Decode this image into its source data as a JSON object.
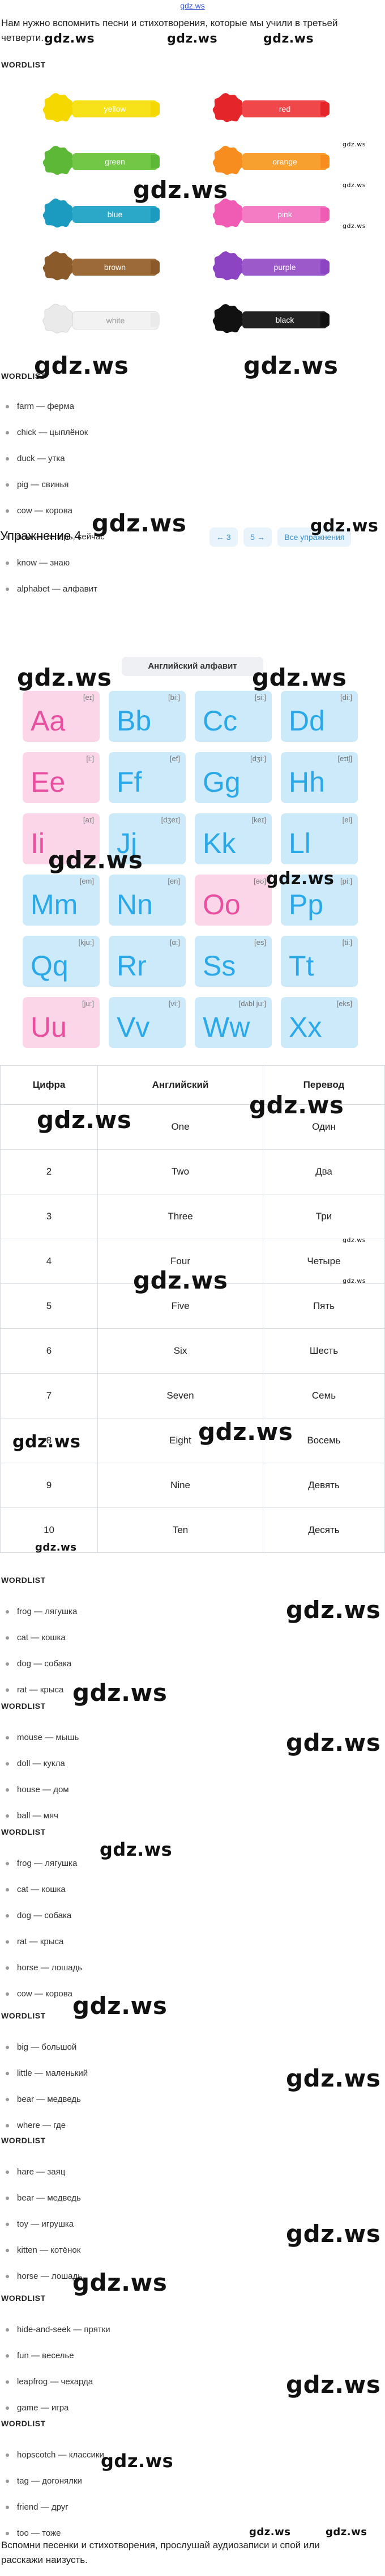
{
  "top_link": "gdz.ws",
  "intro_text": "Нам нужно вспомнить песни и стихотворения, которые мы учили в третьей четверти.",
  "wordlist_label": "WORDLIST",
  "watermarks": {
    "big": "gdz.ws",
    "small": "gdz.ws"
  },
  "highlighters": [
    {
      "label": "yellow",
      "color": "#f7e21a",
      "splat": "#f5d800"
    },
    {
      "label": "red",
      "color": "#f0484a",
      "splat": "#e4262a"
    },
    {
      "label": "green",
      "color": "#72c846",
      "splat": "#5db837"
    },
    {
      "label": "orange",
      "color": "#f7a030",
      "splat": "#f68d1e"
    },
    {
      "label": "blue",
      "color": "#2ba8c8",
      "splat": "#1a9bbf"
    },
    {
      "label": "pink",
      "color": "#f47cc5",
      "splat": "#f05cb4"
    },
    {
      "label": "brown",
      "color": "#9c6a38",
      "splat": "#8a5a2a"
    },
    {
      "label": "purple",
      "color": "#9b59c9",
      "splat": "#8c44c2"
    },
    {
      "label": "white",
      "color": "#f2f2f2",
      "splat": "#eaeaea"
    },
    {
      "label": "black",
      "color": "#222222",
      "splat": "#111111"
    }
  ],
  "wordlist_1": [
    "farm — ферма",
    "chick — цыплёнок",
    "duck — утка",
    "pig — свинья",
    "cow — корова",
    "now — теперь, сейчас",
    "know — знаю",
    "alphabet — алфавит"
  ],
  "exercise_title": "Упражнение 4",
  "pager": {
    "prev": "← 3",
    "next": "5 →",
    "all": "Все упражнения"
  },
  "alphabet_title": "Английский алфавит",
  "letters": [
    {
      "big": "Aa",
      "tr": "[eɪ]",
      "c": "pink"
    },
    {
      "big": "Bb",
      "tr": "[bi:]",
      "c": "blue"
    },
    {
      "big": "Cc",
      "tr": "[si:]",
      "c": "blue"
    },
    {
      "big": "Dd",
      "tr": "[di:]",
      "c": "blue"
    },
    {
      "big": "Ee",
      "tr": "[i:]",
      "c": "pink"
    },
    {
      "big": "Ff",
      "tr": "[ef]",
      "c": "blue"
    },
    {
      "big": "Gg",
      "tr": "[dʒi:]",
      "c": "blue"
    },
    {
      "big": "Hh",
      "tr": "[eɪtʃ]",
      "c": "blue"
    },
    {
      "big": "Ii",
      "tr": "[aɪ]",
      "c": "pink"
    },
    {
      "big": "Jj",
      "tr": "[dʒeɪ]",
      "c": "blue"
    },
    {
      "big": "Kk",
      "tr": "[keɪ]",
      "c": "blue"
    },
    {
      "big": "Ll",
      "tr": "[el]",
      "c": "blue"
    },
    {
      "big": "Mm",
      "tr": "[em]",
      "c": "blue"
    },
    {
      "big": "Nn",
      "tr": "[en]",
      "c": "blue"
    },
    {
      "big": "Oo",
      "tr": "[əʊ]",
      "c": "pink"
    },
    {
      "big": "Pp",
      "tr": "[pi:]",
      "c": "blue"
    },
    {
      "big": "Qq",
      "tr": "[kju:]",
      "c": "blue"
    },
    {
      "big": "Rr",
      "tr": "[ɑ:]",
      "c": "blue"
    },
    {
      "big": "Ss",
      "tr": "[es]",
      "c": "blue"
    },
    {
      "big": "Tt",
      "tr": "[ti:]",
      "c": "blue"
    },
    {
      "big": "Uu",
      "tr": "[ju:]",
      "c": "pink"
    },
    {
      "big": "Vv",
      "tr": "[vi:]",
      "c": "blue"
    },
    {
      "big": "Ww",
      "tr": "[dʌbl ju:]",
      "c": "blue"
    },
    {
      "big": "Xx",
      "tr": "[eks]",
      "c": "blue"
    }
  ],
  "numbers_table": {
    "headers": [
      "Цифра",
      "Английский",
      "Перевод"
    ],
    "rows": [
      [
        "1",
        "One",
        "Один"
      ],
      [
        "2",
        "Two",
        "Два"
      ],
      [
        "3",
        "Three",
        "Три"
      ],
      [
        "4",
        "Four",
        "Четыре"
      ],
      [
        "5",
        "Five",
        "Пять"
      ],
      [
        "6",
        "Six",
        "Шесть"
      ],
      [
        "7",
        "Seven",
        "Семь"
      ],
      [
        "8",
        "Eight",
        "Восемь"
      ],
      [
        "9",
        "Nine",
        "Девять"
      ],
      [
        "10",
        "Ten",
        "Десять"
      ]
    ]
  },
  "wordlist_2": [
    "frog — лягушка",
    "cat — кошка",
    "dog — собака",
    "rat — крыса"
  ],
  "wordlist_3": [
    "mouse — мышь",
    "doll — кукла",
    "house — дом",
    "ball — мяч"
  ],
  "wordlist_4": [
    "frog — лягушка",
    "cat — кошка",
    "dog — собака",
    "rat — крыса",
    "horse — лошадь",
    "cow — корова"
  ],
  "wordlist_5": [
    "big — большой",
    "little — маленький",
    "bear — медведь",
    "where — где"
  ],
  "wordlist_6": [
    "hare — заяц",
    "bear — медведь",
    "toy — игрушка",
    "kitten — котёнок",
    "horse — лошадь"
  ],
  "wordlist_7": [
    "hide-and-seek — прятки",
    "fun — веселье",
    "leapfrog — чехарда",
    "game — игра"
  ],
  "wordlist_8": [
    "hopscotch — классики",
    "tag — догонялки",
    "friend — друг",
    "too — тоже"
  ],
  "footer_text": "Вспомни песенки и стихотворения, прослушай аудиозаписи и спой или расскажи наизусть."
}
